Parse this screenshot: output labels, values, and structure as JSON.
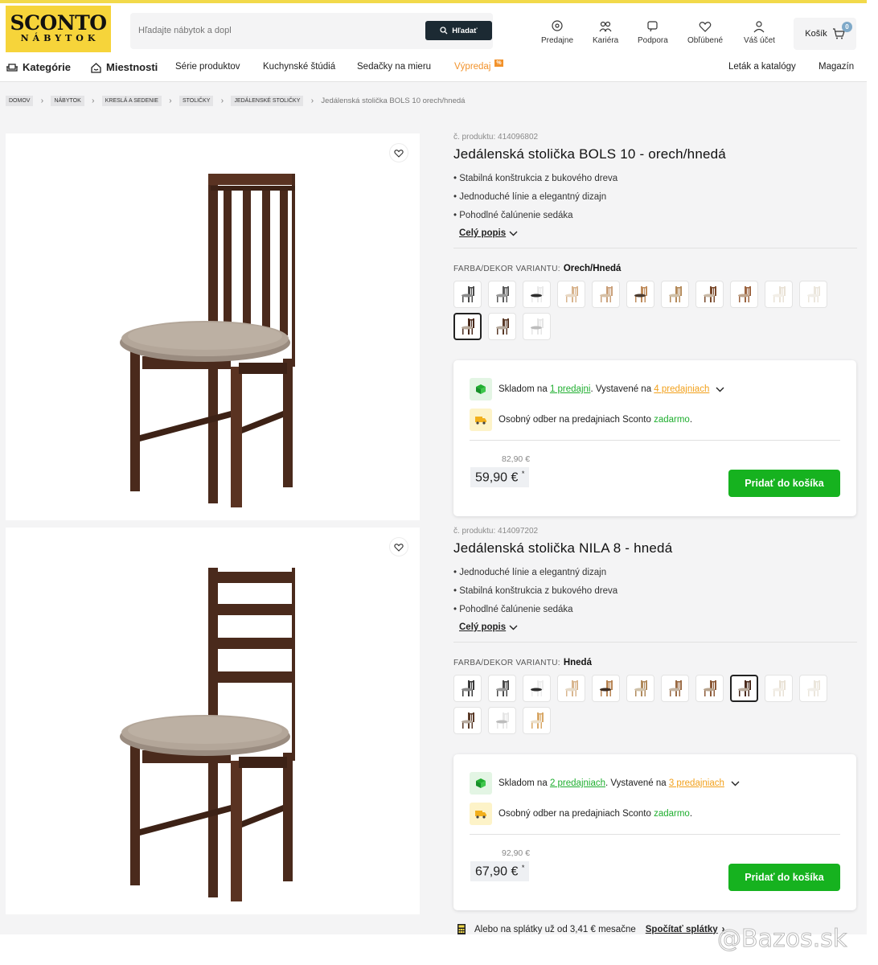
{
  "logo": {
    "line1": "SCONTO",
    "line2": "NÁBYTOK"
  },
  "search": {
    "placeholder": "Hľadajte nábytok a dopl",
    "button": "Hľadať"
  },
  "header_icons": [
    {
      "label": "Predajne",
      "icon": "location-pin-icon"
    },
    {
      "label": "Kariéra",
      "icon": "people-icon"
    },
    {
      "label": "Podpora",
      "icon": "chat-icon"
    },
    {
      "label": "Obľúbené",
      "icon": "heart-icon"
    },
    {
      "label": "Váš účet",
      "icon": "user-icon"
    }
  ],
  "cart": {
    "label": "Košík",
    "count": "0"
  },
  "nav": {
    "categories": "Kategórie",
    "rooms": "Miestnosti",
    "series": "Série produktov",
    "kitchen": "Kuchynské štúdiá",
    "sofas": "Sedačky na mieru",
    "sale": "Výpredaj",
    "sale_badge": "%",
    "leaflet": "Leták a katalógy",
    "magazine": "Magazín"
  },
  "breadcrumb": {
    "items": [
      "DOMOV",
      "NÁBYTOK",
      "KRESLÁ A SEDENIE",
      "STOLIČKY",
      "JEDÁLENSKÉ STOLIČKY"
    ],
    "current": "Jedálenská stolička BOLS 10 orech/hnedá"
  },
  "products": [
    {
      "code": "č. produktu: 414096802",
      "title": "Jedálenská stolička BOLS 10 - orech/hnedá",
      "bullets": [
        "Stabilná konštrukcia z bukového dreva",
        "Jednoduché línie a elegantný dizajn",
        "Pohodlné čalúnenie sedáka"
      ],
      "desc_link": "Celý popis",
      "variant_label": "FARBA/DEKOR VARIANTU:",
      "variant_value": "Orech/Hnedá",
      "stock_prefix": "Skladom na ",
      "stock_link": "1 predajni",
      "display_prefix": ". Vystavené na ",
      "display_link": "4 predajniach",
      "pickup_text": "Osobný odber na predajniach Sconto ",
      "pickup_free": "zadarmo",
      "pickup_suffix": ".",
      "old_price": "82,90 €",
      "price": "59,90 €",
      "price_mark": "*",
      "add_button": "Pridať do košíka"
    },
    {
      "code": "č. produktu: 414097202",
      "title": "Jedálenská stolička NILA 8 - hnedá",
      "bullets": [
        "Jednoduché línie a elegantný dizajn",
        "Stabilná konštrukcia z bukového dreva",
        "Pohodlné čalúnenie sedáka"
      ],
      "desc_link": "Celý popis",
      "variant_label": "FARBA/DEKOR VARIANTU:",
      "variant_value": "Hnedá",
      "stock_prefix": "Skladom na ",
      "stock_link": "2 predajniach",
      "display_prefix": ". Vystavené na ",
      "display_link": "3 predajniach",
      "pickup_text": "Osobný odber na predajniach Sconto ",
      "pickup_free": "zadarmo",
      "pickup_suffix": ".",
      "old_price": "92,90 €",
      "price": "67,90 €",
      "price_mark": "*",
      "add_button": "Pridať do košíka"
    }
  ],
  "installments": {
    "text": "Alebo na splátky už od 3,41 € mesačne",
    "link": "Spočítať splátky"
  },
  "watermark": "@Bazos.sk",
  "colors": {
    "brand_yellow": "#f6d43a",
    "green": "#16b21f",
    "orange": "#f2922b",
    "dark_wood": "#4a2a1c"
  }
}
